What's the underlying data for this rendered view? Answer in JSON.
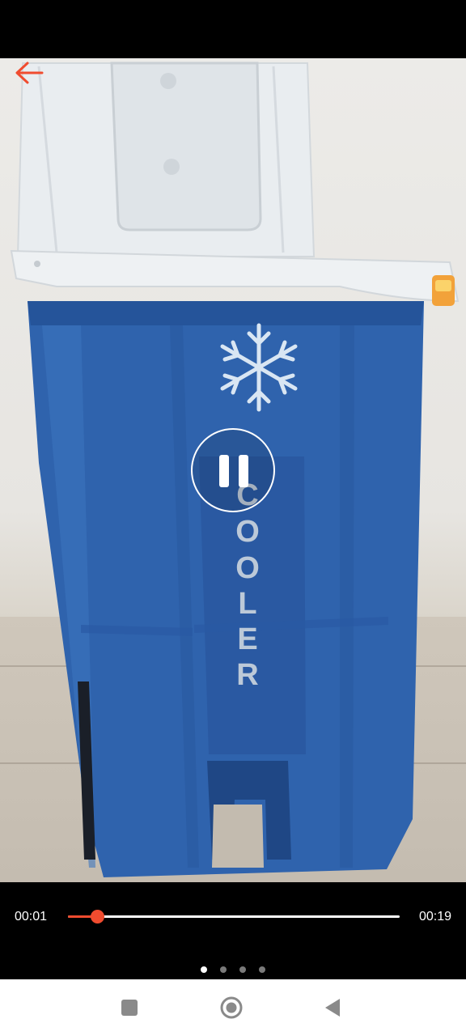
{
  "player": {
    "current_time": "00:01",
    "duration": "00:19",
    "progress_fraction": 0.087,
    "accent_color": "#f04c2f",
    "state": "playing",
    "pause_icon": "pause-icon",
    "back_icon": "arrow-left-icon"
  },
  "video": {
    "overlay_text": "COOLER",
    "emblem_icon": "snowflake-icon"
  },
  "pager": {
    "count": 4,
    "active_index": 0
  },
  "navigation": {
    "buttons": [
      "recents-icon",
      "home-icon",
      "back-triangle-icon"
    ]
  }
}
